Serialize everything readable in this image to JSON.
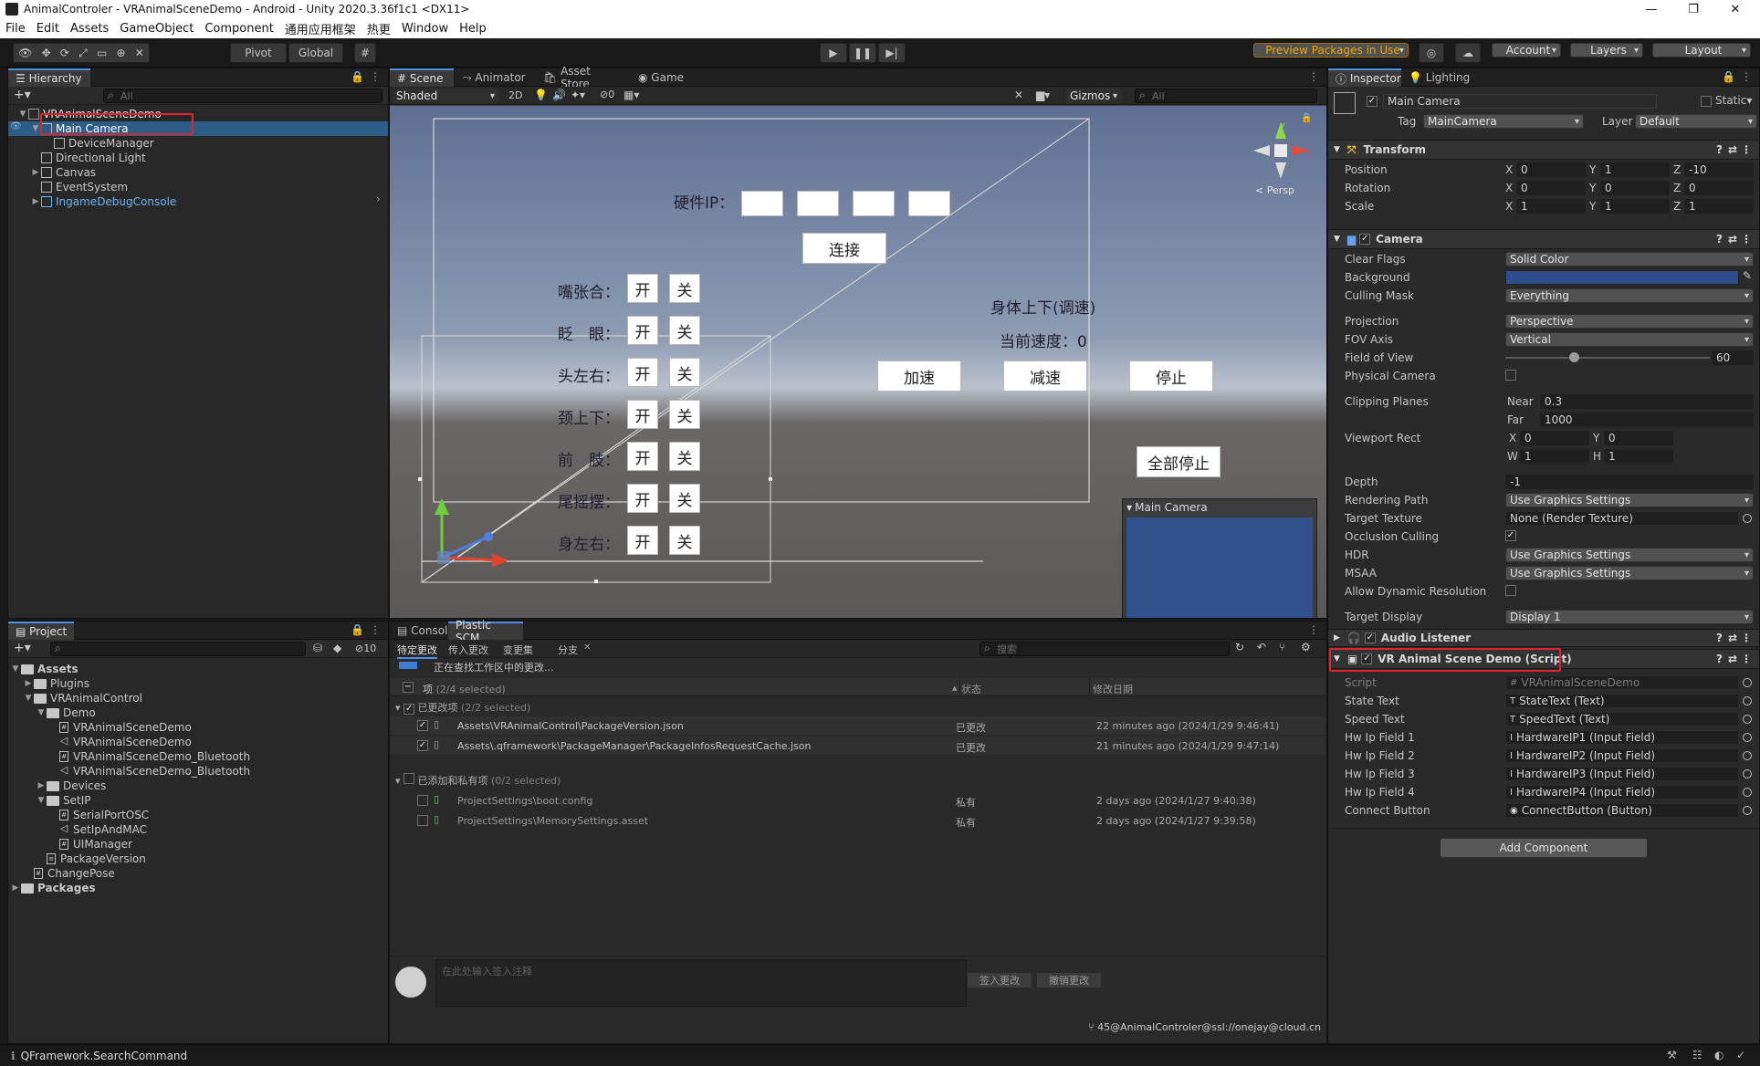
{
  "window": {
    "title": "AnimalControler - VRAnimalSceneDemo - Android - Unity 2020.3.36f1c1 <DX11>"
  },
  "menu": [
    "File",
    "Edit",
    "Assets",
    "GameObject",
    "Component",
    "通用应用框架",
    "热更",
    "Window",
    "Help"
  ],
  "toolbar": {
    "pivot": "Pivot",
    "global": "Global",
    "preview_packages": "Preview Packages in Use",
    "account": "Account",
    "layers": "Layers",
    "layout": "Layout"
  },
  "hierarchy": {
    "tab": "Hierarchy",
    "search_placeholder": "All",
    "scene": "VRAnimalSceneDemo",
    "items": [
      {
        "label": "Main Camera",
        "indent": 1,
        "selected": true
      },
      {
        "label": "DeviceManager",
        "indent": 2
      },
      {
        "label": "Directional Light",
        "indent": 1
      },
      {
        "label": "Canvas",
        "indent": 1
      },
      {
        "label": "EventSystem",
        "indent": 1
      },
      {
        "label": "IngameDebugConsole",
        "indent": 1
      }
    ]
  },
  "scene": {
    "tabs": [
      "Scene",
      "Animator",
      "Asset Store",
      "Game"
    ],
    "shading": "Shaded",
    "mode_2d": "2D",
    "hidden_count": "0",
    "gizmos": "Gizmos",
    "search_placeholder": "All",
    "persp": "< Persp",
    "ip_label": "硬件IP：",
    "connect": "连接",
    "rows": [
      "嘴张合：",
      "眨　眼：",
      "头左右：",
      "颈上下：",
      "前　肢：",
      "尾摇摆：",
      "身左右："
    ],
    "on": "开",
    "off": "关",
    "body_title": "身体上下(调速)",
    "speed_text": "当前速度：0",
    "accelerate": "加速",
    "decelerate": "减速",
    "stop": "停止",
    "stop_all": "全部停止",
    "camera_preview": "Main Camera"
  },
  "project": {
    "tab": "Project",
    "hidden_count": "10",
    "items": [
      {
        "label": "Assets",
        "indent": 0,
        "type": "folder",
        "open": true,
        "bold": true
      },
      {
        "label": "Plugins",
        "indent": 1,
        "type": "folder"
      },
      {
        "label": "VRAnimalControl",
        "indent": 1,
        "type": "folder",
        "open": true
      },
      {
        "label": "Demo",
        "indent": 2,
        "type": "folder",
        "open": true
      },
      {
        "label": "VRAnimalSceneDemo",
        "indent": 3,
        "type": "script"
      },
      {
        "label": "VRAnimalSceneDemo",
        "indent": 3,
        "type": "scene"
      },
      {
        "label": "VRAnimalSceneDemo_Bluetooth",
        "indent": 3,
        "type": "script"
      },
      {
        "label": "VRAnimalSceneDemo_Bluetooth",
        "indent": 3,
        "type": "scene"
      },
      {
        "label": "Devices",
        "indent": 2,
        "type": "folder"
      },
      {
        "label": "SetIP",
        "indent": 2,
        "type": "folder",
        "open": true
      },
      {
        "label": "SerialPortOSC",
        "indent": 3,
        "type": "script"
      },
      {
        "label": "SetIpAndMAC",
        "indent": 3,
        "type": "scene"
      },
      {
        "label": "UIManager",
        "indent": 3,
        "type": "script"
      },
      {
        "label": "PackageVersion",
        "indent": 2,
        "type": "file"
      },
      {
        "label": "ChangePose",
        "indent": 1,
        "type": "script"
      },
      {
        "label": "Packages",
        "indent": 0,
        "type": "folder",
        "bold": true
      }
    ]
  },
  "console": {
    "tabs": [
      "Console",
      "Plastic SCM"
    ],
    "subtabs": [
      "待定更改",
      "传入更改",
      "变更集",
      "分支"
    ],
    "search_placeholder": "搜索",
    "progress_text": "正在查找工作区中的更改...",
    "col_item": "项",
    "col_item_count": "(2/4 selected)",
    "col_status": "状态",
    "col_date": "修改日期",
    "group_changed": "已更改项",
    "group_changed_count": "(2/2 selected)",
    "group_added": "已添加和私有项",
    "group_added_count": "(0/2 selected)",
    "rows": [
      {
        "path": "Assets\\VRAnimalControl\\PackageVersion.json",
        "status": "已更改",
        "date": "22 minutes ago (2024/1/29 9:46:41)",
        "checked": true
      },
      {
        "path": "Assets\\.qframework\\PackageManager\\PackageInfosRequestCache.json",
        "status": "已更改",
        "date": "21 minutes ago (2024/1/29 9:47:14)",
        "checked": true
      },
      {
        "path": "ProjectSettings\\boot.config",
        "status": "私有",
        "date": "2 days ago (2024/1/27 9:40:38)",
        "checked": false
      },
      {
        "path": "ProjectSettings\\MemorySettings.asset",
        "status": "私有",
        "date": "2 days ago (2024/1/27 9:39:58)",
        "checked": false
      }
    ],
    "comment_placeholder": "在此处输入签入注释",
    "checkin": "签入更改",
    "undo": "撤销更改",
    "footer": "45@AnimalControler@ssl://onejay@cloud.cn"
  },
  "inspector": {
    "tabs": [
      "Inspector",
      "Lighting"
    ],
    "object_name": "Main Camera",
    "static": "Static",
    "tag_label": "Tag",
    "tag": "MainCamera",
    "layer_label": "Layer",
    "layer": "Default",
    "transform": {
      "title": "Transform",
      "position": [
        "0",
        "1",
        "-10"
      ],
      "rotation": [
        "0",
        "0",
        "0"
      ],
      "scale": [
        "1",
        "1",
        "1"
      ]
    },
    "camera": {
      "title": "Camera",
      "clear_flags": "Solid Color",
      "culling_mask": "Everything",
      "projection": "Perspective",
      "fov_axis": "Vertical",
      "fov": "60",
      "near": "0.3",
      "far": "1000",
      "vp_x": "0",
      "vp_y": "0",
      "vp_w": "1",
      "vp_h": "1",
      "depth": "-1",
      "rendering_path": "Use Graphics Settings",
      "target_texture": "None (Render Texture)",
      "hdr": "Use Graphics Settings",
      "msaa": "Use Graphics Settings",
      "target_display": "Display 1",
      "background_color": "#2d4e8a"
    },
    "labels": {
      "position": "Position",
      "rotation": "Rotation",
      "scale": "Scale",
      "clear_flags": "Clear Flags",
      "background": "Background",
      "culling_mask": "Culling Mask",
      "projection": "Projection",
      "fov_axis": "FOV Axis",
      "fov": "Field of View",
      "physical": "Physical Camera",
      "clipping": "Clipping Planes",
      "near": "Near",
      "far": "Far",
      "viewport": "Viewport Rect",
      "depth": "Depth",
      "rendering_path": "Rendering Path",
      "target_texture": "Target Texture",
      "occlusion": "Occlusion Culling",
      "hdr": "HDR",
      "msaa": "MSAA",
      "dynamic_res": "Allow Dynamic Resolution",
      "target_display": "Target Display"
    },
    "audio_listener": "Audio Listener",
    "script_comp": {
      "title": "VR Animal Scene Demo (Script)",
      "fields": [
        {
          "label": "Script",
          "value": "VRAnimalSceneDemo",
          "icon": "#"
        },
        {
          "label": "State Text",
          "value": "StateText (Text)",
          "icon": "T"
        },
        {
          "label": "Speed Text",
          "value": "SpeedText (Text)",
          "icon": "T"
        },
        {
          "label": "Hw Ip Field 1",
          "value": "HardwareIP1 (Input Field)",
          "icon": "I"
        },
        {
          "label": "Hw Ip Field 2",
          "value": "HardwareIP2 (Input Field)",
          "icon": "I"
        },
        {
          "label": "Hw Ip Field 3",
          "value": "HardwareIP3 (Input Field)",
          "icon": "I"
        },
        {
          "label": "Hw Ip Field 4",
          "value": "HardwareIP4 (Input Field)",
          "icon": "I"
        },
        {
          "label": "Connect Button",
          "value": "ConnectButton (Button)",
          "icon": "◉"
        }
      ]
    },
    "add_component": "Add Component"
  },
  "status": {
    "text": "QFramework.SearchCommand"
  }
}
